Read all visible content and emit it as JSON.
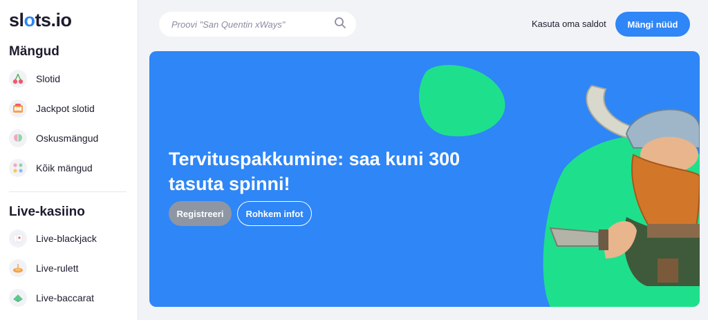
{
  "brand": {
    "logo_prefix": "sl",
    "logo_dot": "o",
    "logo_suffix": "ts.io"
  },
  "sidebar": {
    "games_title": "Mängud",
    "games": [
      {
        "label": "Slotid",
        "icon": "cherries-icon"
      },
      {
        "label": "Jackpot slotid",
        "icon": "jackpot-machine-icon"
      },
      {
        "label": "Oskusmängud",
        "icon": "brain-icon"
      },
      {
        "label": "Kõik mängud",
        "icon": "grid-dots-icon"
      }
    ],
    "live_title": "Live-kasiino",
    "live": [
      {
        "label": "Live-blackjack",
        "icon": "cards-icon"
      },
      {
        "label": "Live-rulett",
        "icon": "roulette-icon"
      },
      {
        "label": "Live-baccarat",
        "icon": "club-icon"
      }
    ]
  },
  "header": {
    "search_placeholder": "Proovi \"San Quentin xWays\"",
    "balance_link": "Kasuta oma saldot",
    "play_button": "Mängi nüüd"
  },
  "banner": {
    "title": "Tervituspakkumine: saa kuni 300 tasuta spinni!",
    "register_button": "Registreeri",
    "info_button": "Rohkem infot"
  },
  "colors": {
    "accent": "#2f86f6",
    "green": "#1ee08c",
    "register_bg": "#8e96a3"
  }
}
